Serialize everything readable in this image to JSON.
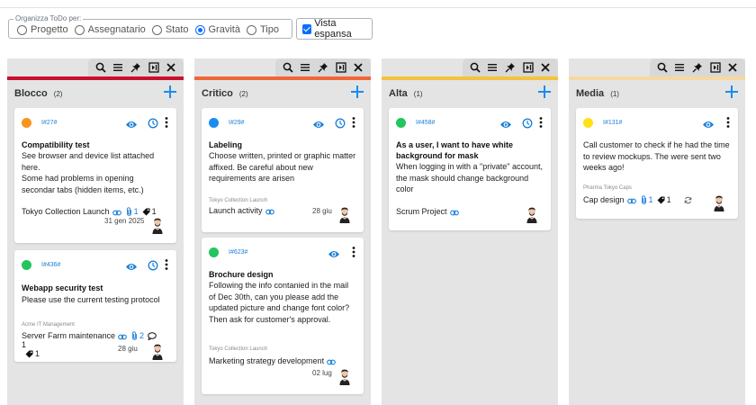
{
  "group_by": {
    "legend": "Organizza ToDo per:",
    "options": [
      {
        "label": "Progetto",
        "checked": false
      },
      {
        "label": "Assegnatario",
        "checked": false
      },
      {
        "label": "Stato",
        "checked": false
      },
      {
        "label": "Gravità",
        "checked": true
      },
      {
        "label": "Tipo",
        "checked": false
      }
    ],
    "expanded_view": {
      "label": "Vista espansa",
      "checked": true
    }
  },
  "toolbar_icons": [
    "search-icon",
    "list-icon",
    "pin-icon",
    "collapse-icon",
    "close-icon"
  ],
  "columns": [
    {
      "title": "Blocco",
      "count": "(2)",
      "color": "#c8102e",
      "cards": [
        {
          "dot_color": "#f7941d",
          "id": "I#27#",
          "title": "Compatibility test",
          "description": "See browser and device list attached here.\nSome had problems in opening secondar tabs (hidden items, etc.)",
          "project": "",
          "link_text": "Tokyo Collection Launch",
          "attachments": "1",
          "tags": "1",
          "comments": "",
          "date": "31 gen 2025"
        },
        {
          "dot_color": "#22c55e",
          "id": "I#436#",
          "title": "Webapp security test",
          "description": "Please use the current testing protocol",
          "project": "Acme IT Management",
          "link_text": "Server Farm maintenance",
          "attachments": "2",
          "tags": "1",
          "comments": "1",
          "date": "28 giu"
        }
      ]
    },
    {
      "title": "Critico",
      "count": "(2)",
      "color": "#f0663a",
      "cards": [
        {
          "dot_color": "#1a8cf0",
          "id": "I#29#",
          "title": "Labeling",
          "description": "Choose written, printed or graphic matter affixed. Be careful about new requirements are arisen",
          "project": "Tokyo Collection Launch",
          "link_text": "Launch activity",
          "attachments": "",
          "tags": "",
          "comments": "",
          "date": "28 giu"
        },
        {
          "dot_color": "#22c55e",
          "id": "I#623#",
          "title": "Brochure design",
          "description": "Following the info contanied in the mail of Dec 30th, can you please add the updated picture and change font color? Then ask for customer's approval.",
          "project": "Tokyo Collection Launch",
          "link_text": "Marketing strategy development",
          "attachments": "",
          "tags": "",
          "comments": "",
          "date": "02 lug"
        }
      ]
    },
    {
      "title": "Alta",
      "count": "(1)",
      "color": "#f5c33b",
      "cards": [
        {
          "dot_color": "#22c55e",
          "id": "I#458#",
          "title": "As a user, I want to have white background for mask",
          "description": "When logging in with a \"private\" account, the mask should change background color",
          "project": "",
          "link_text": "Scrum Project",
          "attachments": "",
          "tags": "",
          "comments": "",
          "date": ""
        }
      ]
    },
    {
      "title": "Media",
      "count": "(1)",
      "color": "#f6d9a0",
      "cards": [
        {
          "dot_color": "#ffe019",
          "id": "I#131#",
          "title": "",
          "description": "Call customer to check if he had the time to review mockups. The were sent two weeks ago!",
          "project": "Pharma Tokyo Caps",
          "link_text": "Cap design",
          "attachments": "1",
          "tags": "1",
          "comments": "",
          "date": ""
        }
      ]
    }
  ]
}
